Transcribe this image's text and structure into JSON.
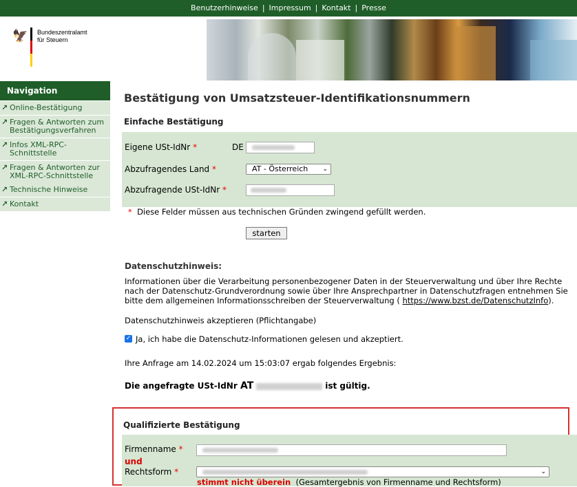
{
  "top_links": [
    "Benutzerhinweise",
    "Impressum",
    "Kontakt",
    "Presse"
  ],
  "logo": {
    "line1": "Bundeszentralamt",
    "line2": "für Steuern",
    "flag_colors": [
      "#000000",
      "#dd0000",
      "#ffce00"
    ]
  },
  "navigation": {
    "title": "Navigation",
    "items": [
      {
        "label1": "Online-Bestätigung",
        "label2": ""
      },
      {
        "label1": "Fragen & Antworten zum",
        "label2": "Bestätigungsverfahren"
      },
      {
        "label1": "Infos XML-RPC-",
        "label2": "Schnittstelle"
      },
      {
        "label1": "Fragen & Antworten zur",
        "label2": "XML-RPC-Schnittstelle"
      },
      {
        "label1": "Technische Hinweise",
        "label2": ""
      },
      {
        "label1": "Kontakt",
        "label2": ""
      }
    ]
  },
  "page_title": "Bestätigung von Umsatzsteuer-Identifikationsnummern",
  "simple": {
    "heading": "Einfache Bestätigung",
    "own_label": "Eigene USt-IdNr",
    "own_prefix": "DE",
    "country_label": "Abzufragendes Land",
    "country_value": "AT - Österreich",
    "query_label": "Abzufragende USt-IdNr",
    "required_mark": "*",
    "required_note": "Diese Felder müssen aus technischen Gründen zwingend gefüllt werden.",
    "submit": "starten"
  },
  "privacy": {
    "heading": "Datenschutzhinweis:",
    "text": "Informationen über die Verarbeitung personenbezogener Daten in der Steuerverwaltung und über Ihre Rechte nach der Datenschutz-Grundverordnung sowie über Ihre Ansprechpartner in Datenschutzfragen entnehmen Sie bitte dem allgemeinen Informationsschreiben der Steuerverwaltung (",
    "link": "https://www.bzst.de/DatenschutzInfo",
    "text_end": ").",
    "accept_label": "Datenschutzhinweis akzeptieren (Pflichtangabe)",
    "checkbox_label": "Ja, ich habe die Datenschutz-Informationen gelesen und akzeptiert.",
    "checked": true
  },
  "result": {
    "line": "Ihre Anfrage am 14.02.2024 um 15:03:07 ergab folgendes Ergebnis:",
    "valid_prefix": "Die angefragte USt-IdNr",
    "valid_country": "AT",
    "valid_suffix": "ist gültig."
  },
  "qualified": {
    "heading": "Qualifizierte Bestätigung",
    "company_label": "Firmenname",
    "und": "und",
    "legal_form_label": "Rechtsform",
    "mismatch_bold": "stimmt nicht überein",
    "mismatch_note": "(Gesamtergebnis von Firmenname und Rechtsform)"
  },
  "colors": {
    "brand_green": "#1f5e29",
    "form_green": "#d6e6d2",
    "highlight_red": "#d63030"
  }
}
